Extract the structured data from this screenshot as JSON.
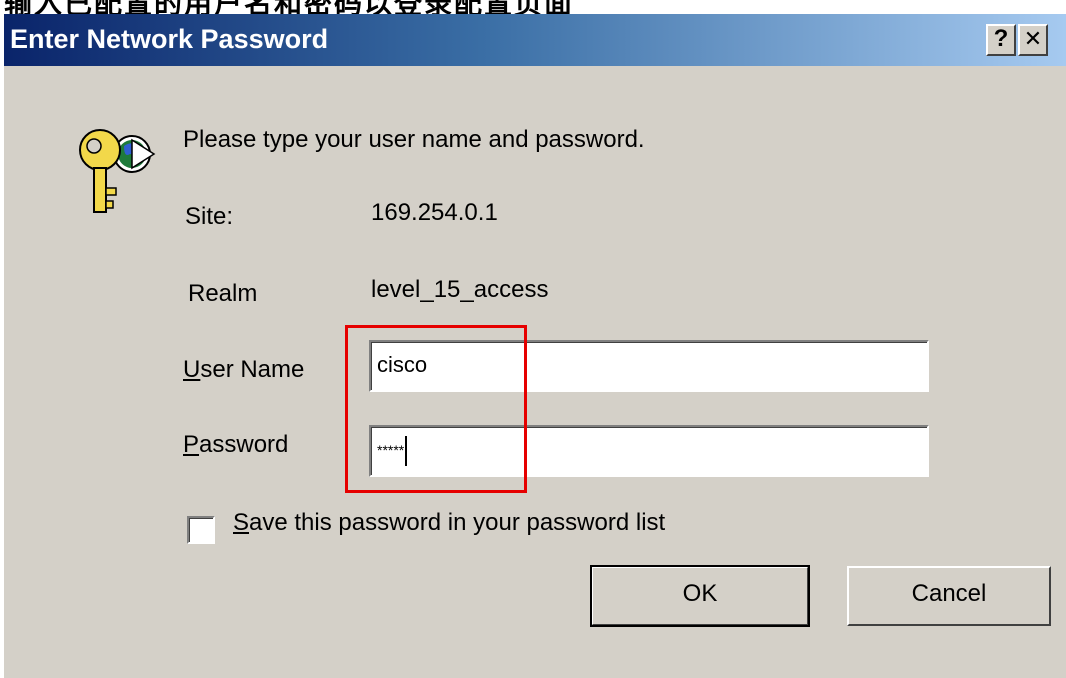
{
  "caption": "输入已配置的用户名和密码以登录配置页面",
  "dialog": {
    "title": "Enter Network Password",
    "help_button": "?",
    "close_button": "✕",
    "prompt": "Please type your user name and password.",
    "site_label": "Site:",
    "site_value": "169.254.0.1",
    "realm_label": "Realm",
    "realm_value": "level_15_access",
    "username_label_first": "U",
    "username_label_rest": "ser Name",
    "username_value": "cisco",
    "password_label_first": "P",
    "password_label_rest": "assword",
    "password_value": "*****",
    "save_label_first": "S",
    "save_label_rest": "ave this password in your password list",
    "save_checked": false,
    "ok_label": "OK",
    "cancel_label": "Cancel"
  },
  "colors": {
    "title_start": "#0a246a",
    "title_end": "#a6caf0",
    "dialog_bg": "#d4d0c8",
    "highlight": "#e60000"
  },
  "icons": {
    "dialog_icon": "key-globe-icon"
  }
}
